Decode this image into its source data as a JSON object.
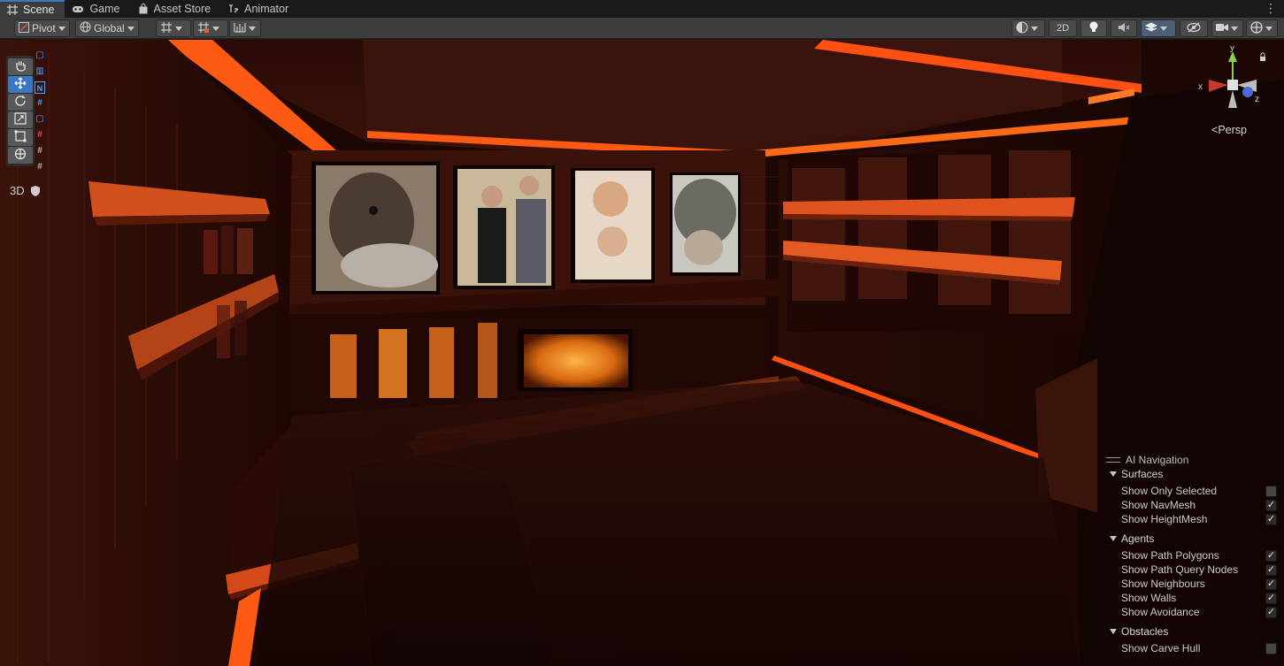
{
  "tabs": [
    {
      "label": "Scene",
      "icon": "grid-icon"
    },
    {
      "label": "Game",
      "icon": "gamepad-icon"
    },
    {
      "label": "Asset Store",
      "icon": "shopping-bag-icon"
    },
    {
      "label": "Animator",
      "icon": "animator-icon"
    }
  ],
  "toolbar": {
    "pivot_label": "Pivot",
    "global_label": "Global",
    "mode_2d_label": "2D"
  },
  "viewport": {
    "persp_label": "Persp",
    "mode_3d_label": "3D",
    "axis_labels": {
      "x": "x",
      "y": "y",
      "z": "z"
    }
  },
  "ai_navigation": {
    "title": "AI Navigation",
    "sections": [
      {
        "name": "Surfaces",
        "options": [
          {
            "label": "Show Only Selected",
            "checked": false
          },
          {
            "label": "Show NavMesh",
            "checked": true
          },
          {
            "label": "Show HeightMesh",
            "checked": true
          }
        ]
      },
      {
        "name": "Agents",
        "options": [
          {
            "label": "Show Path Polygons",
            "checked": true
          },
          {
            "label": "Show Path Query Nodes",
            "checked": true
          },
          {
            "label": "Show Neighbours",
            "checked": true
          },
          {
            "label": "Show Walls",
            "checked": true
          },
          {
            "label": "Show Avoidance",
            "checked": true
          }
        ]
      },
      {
        "name": "Obstacles",
        "options": [
          {
            "label": "Show Carve Hull",
            "checked": false
          }
        ]
      }
    ]
  },
  "colors": {
    "accent": "#3a79bb",
    "neon": "#ff5a14",
    "wood_dark": "#2a0d07"
  }
}
